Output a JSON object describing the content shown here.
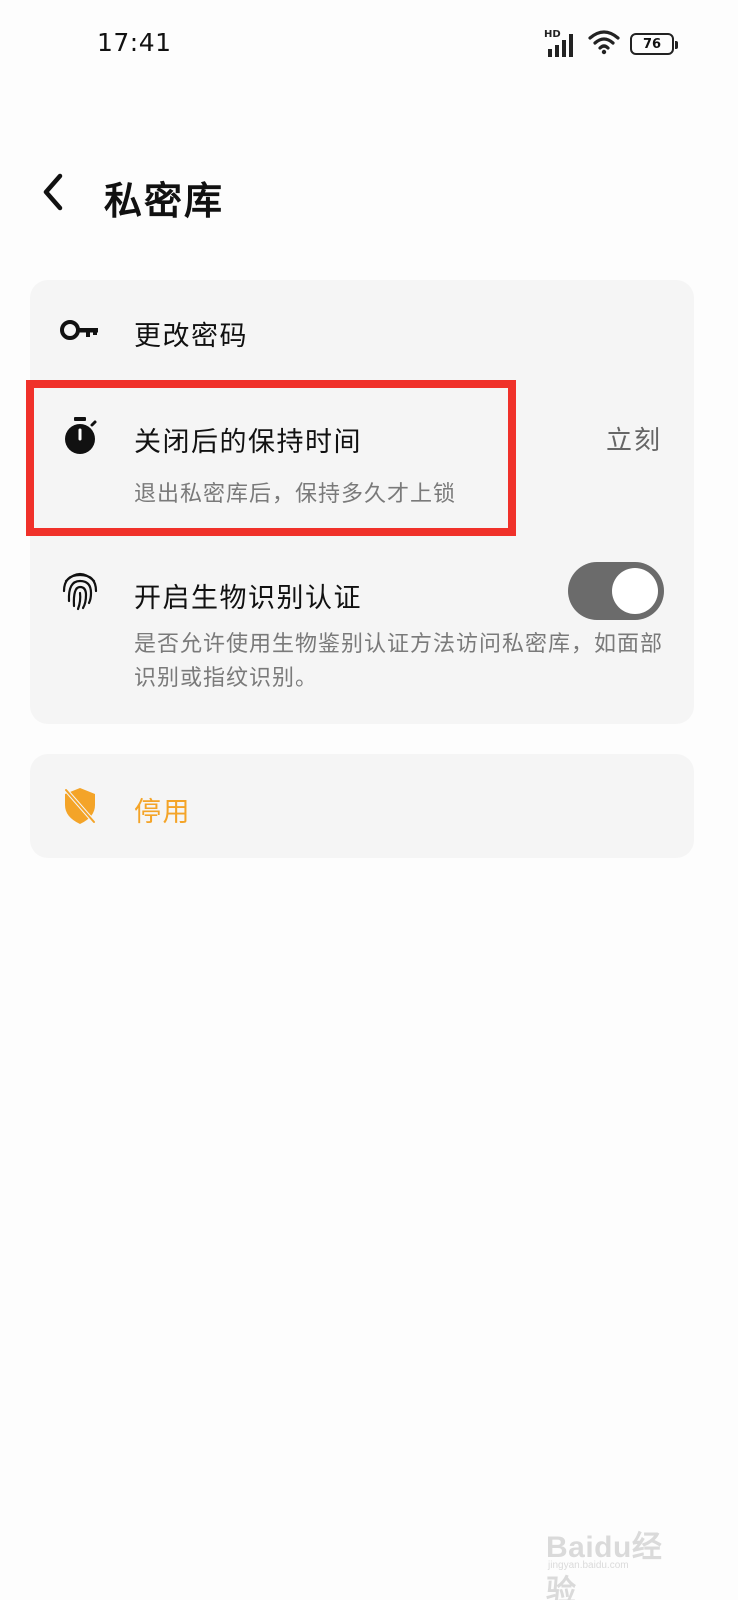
{
  "status_bar": {
    "time": "17:41",
    "network_label": "HD",
    "battery": "76"
  },
  "header": {
    "title": "私密库"
  },
  "settings": {
    "change_password": {
      "title": "更改密码",
      "icon": "key-icon"
    },
    "keep_time": {
      "title": "关闭后的保持时间",
      "subtitle": "退出私密库后，保持多久才上锁",
      "value": "立刻",
      "icon": "stopwatch-icon"
    },
    "biometric": {
      "title": "开启生物识别认证",
      "subtitle": "是否允许使用生物鉴别认证方法访问私密库，如面部识别或指纹识别。",
      "enabled": true,
      "icon": "fingerprint-icon"
    },
    "disable": {
      "title": "停用",
      "icon": "shield-off-icon",
      "color": "#f4a428"
    }
  },
  "watermark": {
    "logo": "Baidu经验",
    "sub": "jingyan.baidu.com"
  },
  "colors": {
    "highlight": "#f0312a",
    "toggle_on": "#6b6b6b",
    "card_bg": "#f5f5f5"
  }
}
